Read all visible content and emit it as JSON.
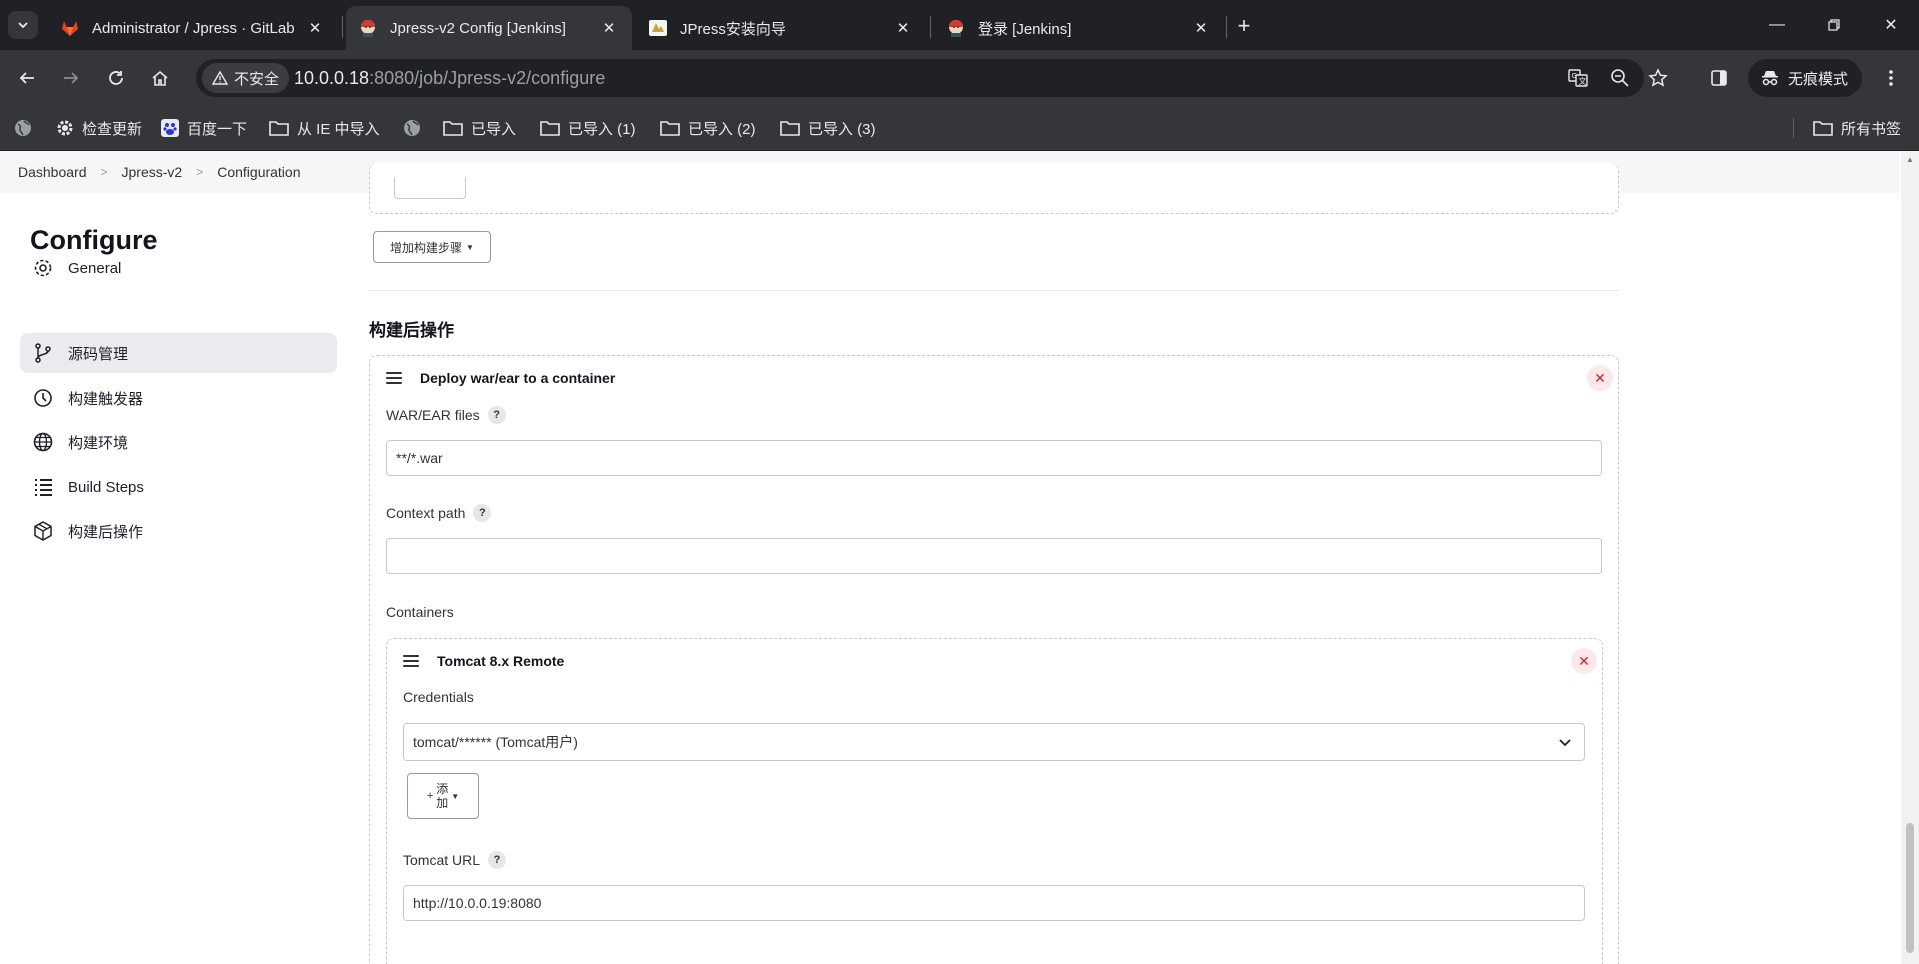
{
  "browser": {
    "tabs": [
      {
        "title": "Administrator / Jpress · GitLab",
        "icon": "gitlab-icon",
        "active": false
      },
      {
        "title": "Jpress-v2 Config [Jenkins]",
        "icon": "jenkins-icon",
        "active": true
      },
      {
        "title": "JPress安装向导",
        "icon": "jpress-icon",
        "active": false
      },
      {
        "title": "登录 [Jenkins]",
        "icon": "jenkins-icon",
        "active": false
      }
    ],
    "security_label": "不安全",
    "url_host": "10.0.0.18",
    "url_rest": ":8080/job/Jpress-v2/configure",
    "incognito_label": "无痕模式",
    "bookmarks": [
      {
        "label": "检查更新"
      },
      {
        "label": "百度一下"
      },
      {
        "label": "从 IE 中导入"
      },
      {
        "label": ""
      },
      {
        "label": "已导入"
      },
      {
        "label": "已导入 (1)"
      },
      {
        "label": "已导入 (2)"
      },
      {
        "label": "已导入 (3)"
      }
    ],
    "all_bookmarks": "所有书签"
  },
  "breadcrumb": [
    "Dashboard",
    "Jpress-v2",
    "Configuration"
  ],
  "sidebar": {
    "title": "Configure",
    "items": [
      {
        "label": "General",
        "icon": "gear-icon",
        "active": false
      },
      {
        "label": "源码管理",
        "icon": "branch-icon",
        "active": true
      },
      {
        "label": "构建触发器",
        "icon": "clock-icon",
        "active": false
      },
      {
        "label": "构建环境",
        "icon": "globe-icon",
        "active": false
      },
      {
        "label": "Build Steps",
        "icon": "list-icon",
        "active": false
      },
      {
        "label": "构建后操作",
        "icon": "package-icon",
        "active": false
      }
    ]
  },
  "main": {
    "add_build_step": "增加构建步骤",
    "post_build_heading": "构建后操作",
    "deploy": {
      "title": "Deploy war/ear to a container",
      "war_label": "WAR/EAR files",
      "war_value": "**/*.war",
      "context_label": "Context path",
      "context_value": "",
      "containers_label": "Containers",
      "container": {
        "title": "Tomcat 8.x Remote",
        "credentials_label": "Credentials",
        "credentials_value": "tomcat/****** (Tomcat用户)",
        "add_label_1": "添",
        "add_label_2": "加",
        "url_label": "Tomcat URL",
        "url_value": "http://10.0.0.19:8080"
      }
    }
  }
}
